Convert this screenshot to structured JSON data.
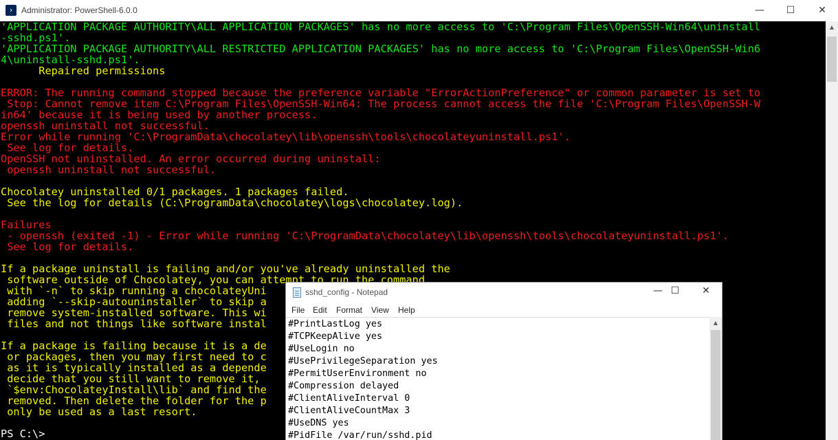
{
  "powershell": {
    "title": "Administrator: PowerShell-6.0.0",
    "icon": "powershell-icon",
    "colors": {
      "background": "#000000",
      "green": "#13e61a",
      "yellow": "#f2f200",
      "red": "#f21d1d",
      "white": "#ffffff"
    },
    "lines": [
      {
        "text": "'APPLICATION PACKAGE AUTHORITY\\ALL APPLICATION PACKAGES' has no more access to 'C:\\Program Files\\OpenSSH-Win64\\uninstall",
        "color": "green"
      },
      {
        "text": "-sshd.ps1'.",
        "color": "green"
      },
      {
        "text": "'APPLICATION PACKAGE AUTHORITY\\ALL RESTRICTED APPLICATION PACKAGES' has no more access to 'C:\\Program Files\\OpenSSH-Win6",
        "color": "green"
      },
      {
        "text": "4\\uninstall-sshd.ps1'.",
        "color": "green"
      },
      {
        "text": "      Repaired permissions",
        "color": "yellow"
      },
      {
        "text": "",
        "color": "yellow"
      },
      {
        "text": "ERROR: The running command stopped because the preference variable \"ErrorActionPreference\" or common parameter is set to",
        "color": "red"
      },
      {
        "text": " Stop: Cannot remove item C:\\Program Files\\OpenSSH-Win64: The process cannot access the file 'C:\\Program Files\\OpenSSH-W",
        "color": "red"
      },
      {
        "text": "in64' because it is being used by another process.",
        "color": "red"
      },
      {
        "text": "openssh uninstall not successful.",
        "color": "red"
      },
      {
        "text": "Error while running 'C:\\ProgramData\\chocolatey\\lib\\openssh\\tools\\chocolateyuninstall.ps1'.",
        "color": "red"
      },
      {
        "text": " See log for details.",
        "color": "red"
      },
      {
        "text": "OpenSSH not uninstalled. An error occurred during uninstall:",
        "color": "red"
      },
      {
        "text": " openssh uninstall not successful.",
        "color": "red"
      },
      {
        "text": "",
        "color": "red"
      },
      {
        "text": "Chocolatey uninstalled 0/1 packages. 1 packages failed.",
        "color": "yellow"
      },
      {
        "text": " See the log for details (C:\\ProgramData\\chocolatey\\logs\\chocolatey.log).",
        "color": "yellow"
      },
      {
        "text": "",
        "color": "yellow"
      },
      {
        "text": "Failures",
        "color": "red"
      },
      {
        "text": " - openssh (exited -1) - Error while running 'C:\\ProgramData\\chocolatey\\lib\\openssh\\tools\\chocolateyuninstall.ps1'.",
        "color": "red"
      },
      {
        "text": " See log for details.",
        "color": "red"
      },
      {
        "text": "",
        "color": "red"
      },
      {
        "text": "If a package uninstall is failing and/or you've already uninstalled the",
        "color": "yellow"
      },
      {
        "text": " software outside of Chocolatey, you can attempt to run the command",
        "color": "yellow"
      },
      {
        "text": " with `-n` to skip running a chocolateyUni",
        "color": "yellow"
      },
      {
        "text": " adding `--skip-autouninstaller` to skip a",
        "color": "yellow"
      },
      {
        "text": " remove system-installed software. This wi",
        "color": "yellow"
      },
      {
        "text": " files and not things like software instal",
        "color": "yellow"
      },
      {
        "text": "",
        "color": "yellow"
      },
      {
        "text": "If a package is failing because it is a de",
        "color": "yellow"
      },
      {
        "text": " or packages, then you may first need to c",
        "color": "yellow"
      },
      {
        "text": " as it is typically installed as a depende",
        "color": "yellow"
      },
      {
        "text": " decide that you still want to remove it,",
        "color": "yellow"
      },
      {
        "text": " `$env:ChocolateyInstall\\lib` and find the",
        "color": "yellow"
      },
      {
        "text": " removed. Then delete the folder for the p",
        "color": "yellow"
      },
      {
        "text": " only be used as a last resort.",
        "color": "yellow"
      },
      {
        "text": "",
        "color": "yellow"
      },
      {
        "text": "PS C:\\>",
        "color": "white"
      }
    ]
  },
  "notepad": {
    "title": "sshd_config - Notepad",
    "icon": "notepad-icon",
    "menu": [
      "File",
      "Edit",
      "Format",
      "View",
      "Help"
    ],
    "lines": [
      "#PrintLastLog yes",
      "#TCPKeepAlive yes",
      "#UseLogin no",
      "#UsePrivilegeSeparation yes",
      "#PermitUserEnvironment no",
      "#Compression delayed",
      "#ClientAliveInterval 0",
      "#ClientAliveCountMax 3",
      "#UseDNS yes",
      "#PidFile /var/run/sshd.pid"
    ]
  },
  "window_controls": {
    "minimize": "—",
    "maximize": "☐",
    "close": "✕"
  }
}
